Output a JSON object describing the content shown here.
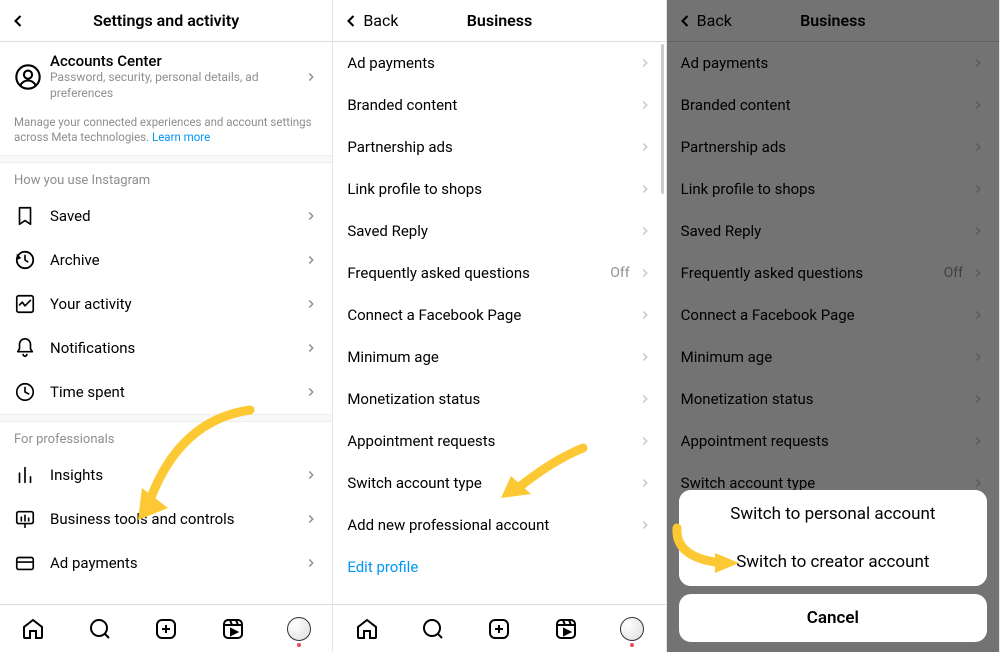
{
  "panel1": {
    "title": "Settings and activity",
    "accounts_center": {
      "title": "Accounts Center",
      "subtitle": "Password, security, personal details, ad preferences"
    },
    "help_text": "Manage your connected experiences and account settings across Meta technologies.",
    "help_link": "Learn more",
    "section1_header": "How you use Instagram",
    "section1_items": [
      {
        "label": "Saved",
        "icon": "bookmark"
      },
      {
        "label": "Archive",
        "icon": "clock-reverse"
      },
      {
        "label": "Your activity",
        "icon": "activity"
      },
      {
        "label": "Notifications",
        "icon": "bell"
      },
      {
        "label": "Time spent",
        "icon": "clock"
      }
    ],
    "section2_header": "For professionals",
    "section2_items": [
      {
        "label": "Insights",
        "icon": "bar-chart"
      },
      {
        "label": "Business tools and controls",
        "icon": "presentation"
      },
      {
        "label": "Ad payments",
        "icon": "credit-card"
      }
    ]
  },
  "panel2": {
    "back": "Back",
    "title": "Business",
    "items": [
      {
        "label": "Ad payments",
        "value": ""
      },
      {
        "label": "Branded content",
        "value": ""
      },
      {
        "label": "Partnership ads",
        "value": ""
      },
      {
        "label": "Link profile to shops",
        "value": ""
      },
      {
        "label": "Saved Reply",
        "value": ""
      },
      {
        "label": "Frequently asked questions",
        "value": "Off"
      },
      {
        "label": "Connect a Facebook Page",
        "value": ""
      },
      {
        "label": "Minimum age",
        "value": ""
      },
      {
        "label": "Monetization status",
        "value": ""
      },
      {
        "label": "Appointment requests",
        "value": ""
      },
      {
        "label": "Switch account type",
        "value": ""
      },
      {
        "label": "Add new professional account",
        "value": ""
      }
    ],
    "edit_profile": "Edit profile"
  },
  "panel3": {
    "back": "Back",
    "title": "Business",
    "items": [
      {
        "label": "Ad payments",
        "value": ""
      },
      {
        "label": "Branded content",
        "value": ""
      },
      {
        "label": "Partnership ads",
        "value": ""
      },
      {
        "label": "Link profile to shops",
        "value": ""
      },
      {
        "label": "Saved Reply",
        "value": ""
      },
      {
        "label": "Frequently asked questions",
        "value": "Off"
      },
      {
        "label": "Connect a Facebook Page",
        "value": ""
      },
      {
        "label": "Minimum age",
        "value": ""
      },
      {
        "label": "Monetization status",
        "value": ""
      },
      {
        "label": "Appointment requests",
        "value": ""
      },
      {
        "label": "Switch account type",
        "value": ""
      }
    ],
    "sheet": {
      "option1": "Switch to personal account",
      "option2": "Switch to creator account",
      "cancel": "Cancel"
    }
  }
}
